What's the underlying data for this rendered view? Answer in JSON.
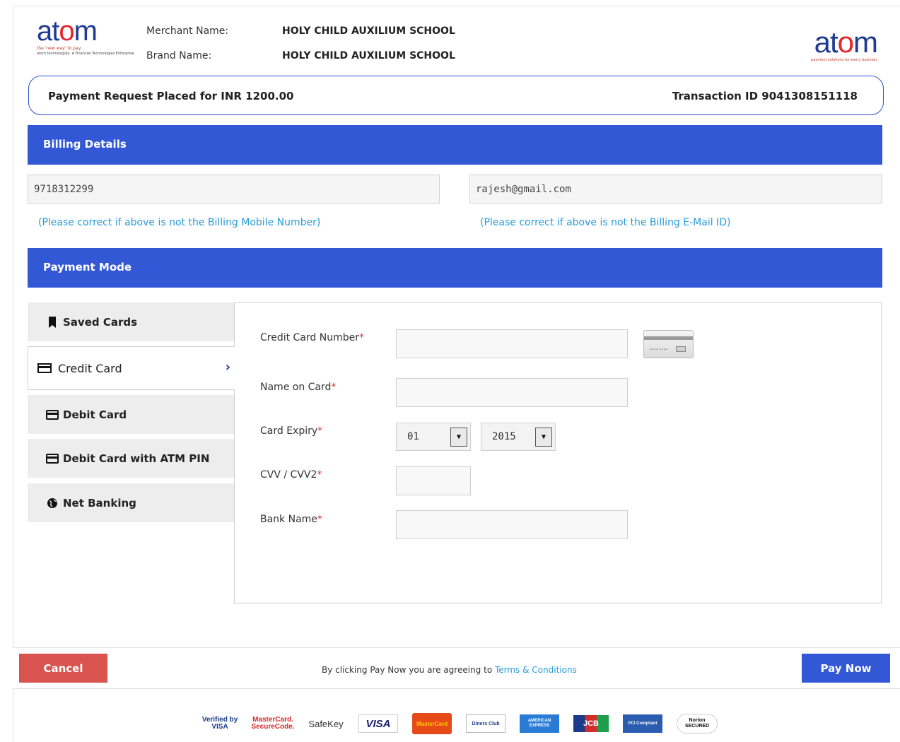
{
  "header": {
    "logo_left": {
      "word_a": "at",
      "word_o": "o",
      "word_m": "m",
      "tagline": "the 'new way' to pay",
      "sub": "atom technologies. A Financial Technologies Enterprise"
    },
    "merchant_label": "Merchant Name:",
    "merchant_value": "HOLY CHILD AUXILIUM SCHOOL",
    "brand_label": "Brand Name:",
    "brand_value": "HOLY CHILD AUXILIUM SCHOOL",
    "logo_right": {
      "word_a": "at",
      "word_o": "o",
      "word_m": "m",
      "tagline": "payment solutions for every business"
    }
  },
  "request": {
    "text": "Payment Request Placed for INR  1200.00",
    "transaction": "Transaction ID  9041308151118"
  },
  "billing": {
    "title": "Billing Details",
    "mobile_value": "9718312299",
    "email_value": "rajesh@gmail.com",
    "mobile_hint": "(Please correct if above is not the Billing Mobile Number)",
    "email_hint": "(Please correct if above is not the Billing E-Mail ID)"
  },
  "payment_mode": {
    "title": "Payment Mode",
    "tabs": [
      {
        "label": "Saved Cards",
        "icon": "bookmark-icon"
      },
      {
        "label": "Credit Card",
        "icon": "credit-card-icon",
        "active": true
      },
      {
        "label": "Debit Card",
        "icon": "debit-card-icon"
      },
      {
        "label": "Debit Card with ATM PIN",
        "icon": "debit-card-icon"
      },
      {
        "label": "Net Banking",
        "icon": "globe-icon"
      }
    ]
  },
  "form": {
    "card_number_label": "Credit Card Number",
    "name_label": "Name on Card",
    "expiry_label": "Card Expiry",
    "expiry_month": "01",
    "expiry_year": "2015",
    "cvv_label": "CVV / CVV2",
    "bank_label": "Bank Name",
    "required_mark": "*"
  },
  "footer": {
    "cancel_label": "Cancel",
    "agree_text": "By clicking Pay Now you are agreeing to ",
    "terms_link": "Terms & Conditions",
    "pay_label": "Pay Now"
  },
  "security_logos": {
    "verified_visa": "Verified by VISA",
    "mastercard_secure": "MasterCard. SecureCode.",
    "safekey": "SafeKey",
    "visa": "VISA",
    "mastercard": "MasterCard",
    "diners": "Diners Club",
    "amex": "AMERICAN EXPRESS",
    "jcb": "JCB",
    "pci": "PCI Compliant",
    "norton": "Norton SECURED"
  },
  "colors": {
    "primary": "#3358d6",
    "cancel": "#d9534f",
    "hint": "#2a9bd8",
    "required": "#e03030"
  }
}
